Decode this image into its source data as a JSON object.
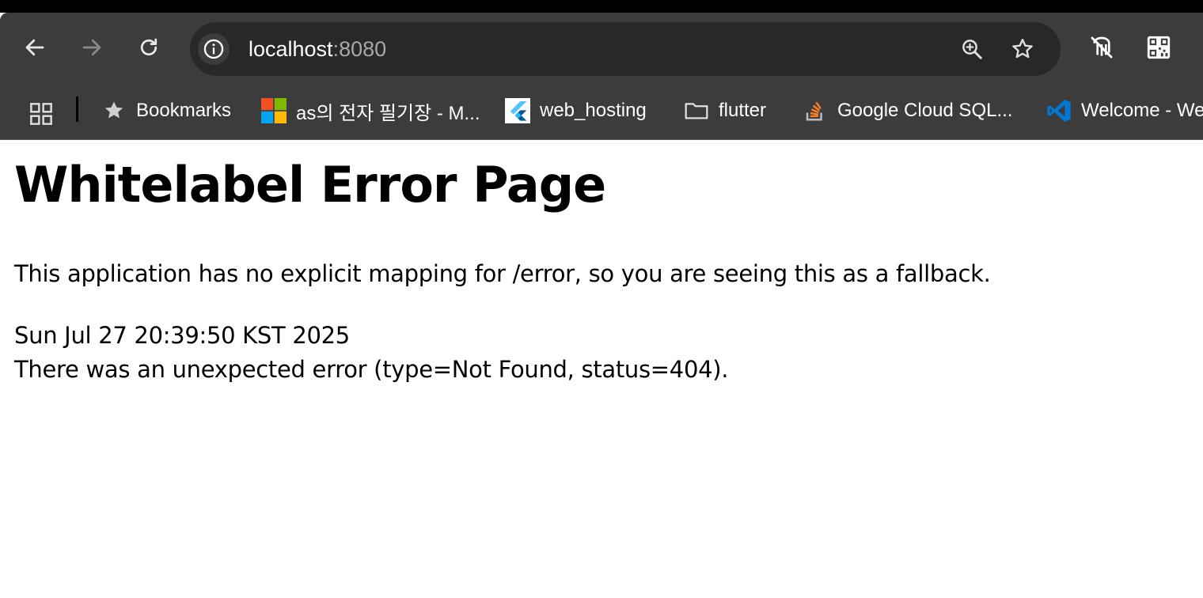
{
  "browser": {
    "address_bar": {
      "host": "localhost",
      "port": ":8080"
    },
    "bookmarks": {
      "folder_label": "Bookmarks",
      "items": [
        {
          "label": "as의 전자 필기장 - M...",
          "icon": "microsoft-icon"
        },
        {
          "label": "web_hosting",
          "icon": "flutter-icon"
        },
        {
          "label": "flutter",
          "icon": "folder-icon"
        },
        {
          "label": "Google Cloud SQL...",
          "icon": "stackoverflow-icon"
        },
        {
          "label": "Welcome - We",
          "icon": "vscode-icon"
        }
      ]
    },
    "colors": {
      "chrome_bg": "#3c3c3c",
      "omnibox_bg": "#282828",
      "port_text": "#a8a8a8"
    }
  },
  "page": {
    "title": "Whitelabel Error Page",
    "message": "This application has no explicit mapping for /error, so you are seeing this as a fallback.",
    "timestamp": "Sun Jul 27 20:39:50 KST 2025",
    "error_detail": "There was an unexpected error (type=Not Found, status=404)."
  }
}
